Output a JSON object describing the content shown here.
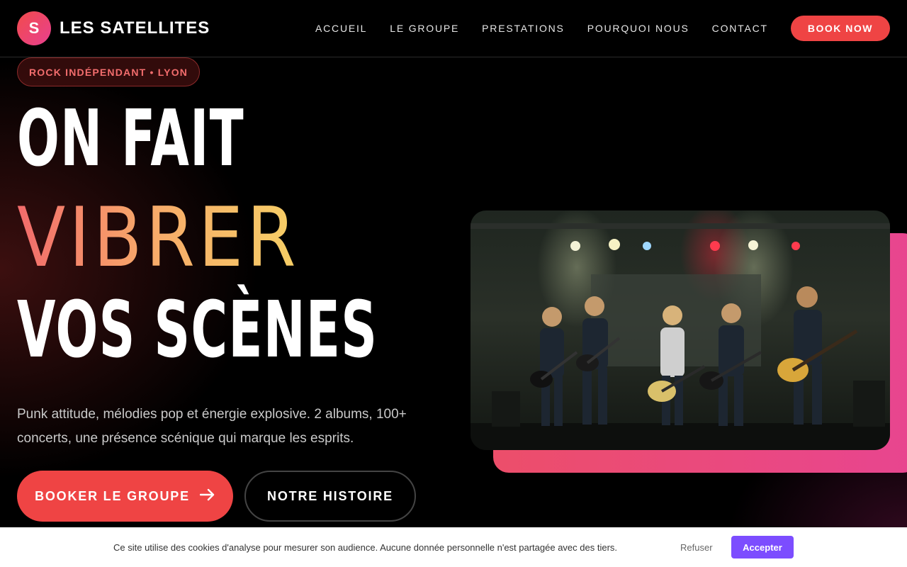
{
  "nav": {
    "logo_letter": "S",
    "brand": "LES SATELLITES",
    "links": [
      "ACCUEIL",
      "LE GROUPE",
      "PRESTATIONS",
      "POURQUOI NOUS",
      "CONTACT"
    ],
    "book_button": "BOOK NOW"
  },
  "hero": {
    "tag": "ROCK INDÉPENDANT • LYON",
    "line1": "ON FAIT",
    "line2": "VIBRER",
    "line3": "VOS SCÈNES",
    "subtitle": "Punk attitude, mélodies pop et énergie explosive. 2 albums, 100+ concerts, une présence scénique qui marque les esprits.",
    "cta_primary": "BOOKER LE GROUPE",
    "cta_secondary": "NOTRE HISTOIRE"
  },
  "cookie": {
    "text": "Ce site utilise des cookies d'analyse pour mesurer son audience. Aucune donnée personnelle n'est partagée avec des tiers.",
    "refuse": "Refuser",
    "accept": "Accepter"
  },
  "colors": {
    "accent": "#ef4444",
    "pink": "#e8408f",
    "cookie_accept": "#7c4dff"
  },
  "icons": {
    "cta_arrow": "arrow-right-icon"
  }
}
